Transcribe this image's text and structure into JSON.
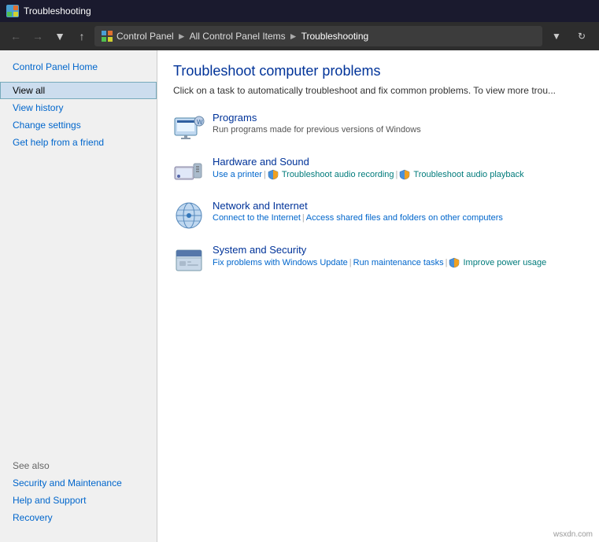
{
  "titlebar": {
    "icon": "control-panel-icon",
    "title": "Troubleshooting"
  },
  "addressbar": {
    "breadcrumbs": [
      {
        "label": "Control Panel",
        "sep": true
      },
      {
        "label": "All Control Panel Items",
        "sep": true
      },
      {
        "label": "Troubleshooting",
        "sep": false
      }
    ]
  },
  "sidebar": {
    "top_link": "Control Panel Home",
    "links": [
      {
        "label": "View all",
        "selected": true
      },
      {
        "label": "View history"
      },
      {
        "label": "Change settings"
      },
      {
        "label": "Get help from a friend"
      }
    ],
    "see_also": "See also",
    "bottom_links": [
      {
        "label": "Security and Maintenance"
      },
      {
        "label": "Help and Support"
      },
      {
        "label": "Recovery"
      }
    ]
  },
  "content": {
    "title": "Troubleshoot computer problems",
    "description": "Click on a task to automatically troubleshoot and fix common problems. To view more trou...",
    "items": [
      {
        "id": "programs",
        "title": "Programs",
        "subtitle": "Run programs made for previous versions of Windows",
        "links": []
      },
      {
        "id": "hardware",
        "title": "Hardware and Sound",
        "subtitle": "",
        "links": [
          {
            "label": "Use a printer",
            "style": "normal"
          },
          {
            "label": "Troubleshoot audio recording",
            "style": "teal"
          },
          {
            "label": "Troubleshoot audio playback",
            "style": "teal"
          }
        ]
      },
      {
        "id": "network",
        "title": "Network and Internet",
        "subtitle": "",
        "links": [
          {
            "label": "Connect to the Internet",
            "style": "normal"
          },
          {
            "label": "Access shared files and folders on other computers",
            "style": "normal"
          }
        ]
      },
      {
        "id": "security",
        "title": "System and Security",
        "subtitle": "",
        "links": [
          {
            "label": "Fix problems with Windows Update",
            "style": "normal"
          },
          {
            "label": "Run maintenance tasks",
            "style": "normal"
          },
          {
            "label": "Improve power usage",
            "style": "teal"
          }
        ]
      }
    ]
  },
  "footer": {
    "watermark": "wsxdn.com"
  }
}
